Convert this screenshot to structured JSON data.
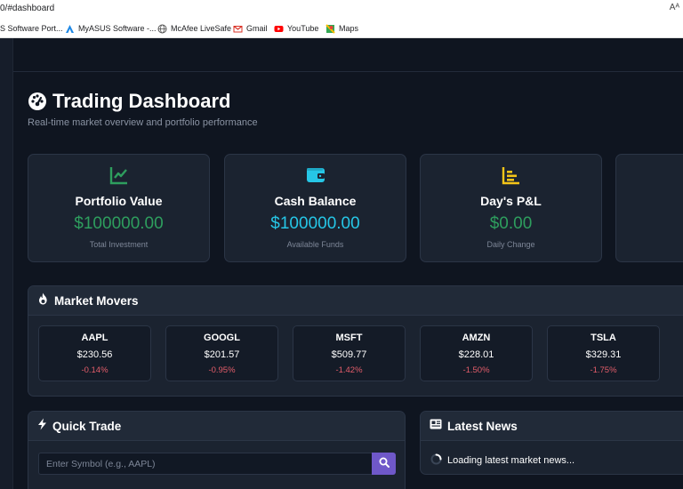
{
  "browser": {
    "url": "0/#dashboard",
    "reader_icon": "Aᴬ",
    "bookmarks": [
      {
        "label": "S Software Port...",
        "icon": "asus-icon"
      },
      {
        "label": "MyASUS Software -...",
        "icon": "myasus-icon"
      },
      {
        "label": "McAfee LiveSafe",
        "icon": "globe-icon"
      },
      {
        "label": "Gmail",
        "icon": "gmail-icon"
      },
      {
        "label": "YouTube",
        "icon": "youtube-icon"
      },
      {
        "label": "Maps",
        "icon": "maps-icon"
      }
    ]
  },
  "header": {
    "title": "Trading Dashboard",
    "subtitle": "Real-time market overview and portfolio performance",
    "icon": "speedometer-icon"
  },
  "stats": [
    {
      "label": "Portfolio Value",
      "value": "$100000.00",
      "note": "Total Investment",
      "icon": "chart-line-icon",
      "color": "#2e9e5e"
    },
    {
      "label": "Cash Balance",
      "value": "$100000.00",
      "note": "Available Funds",
      "icon": "wallet-icon",
      "color": "#26c6e6"
    },
    {
      "label": "Day's P&L",
      "value": "$0.00",
      "note": "Daily Change",
      "icon": "bar-chart-icon",
      "color": "#f5c518"
    }
  ],
  "market_movers": {
    "title": "Market Movers",
    "icon": "fire-icon",
    "items": [
      {
        "symbol": "AAPL",
        "price": "$230.56",
        "change": "-0.14%"
      },
      {
        "symbol": "GOOGL",
        "price": "$201.57",
        "change": "-0.95%"
      },
      {
        "symbol": "MSFT",
        "price": "$509.77",
        "change": "-1.42%"
      },
      {
        "symbol": "AMZN",
        "price": "$228.01",
        "change": "-1.50%"
      },
      {
        "symbol": "TSLA",
        "price": "$329.31",
        "change": "-1.75%"
      }
    ]
  },
  "quick_trade": {
    "title": "Quick Trade",
    "icon": "bolt-icon",
    "input_placeholder": "Enter Symbol (e.g., AAPL)",
    "input_value": ""
  },
  "news": {
    "title": "Latest News",
    "icon": "newspaper-icon",
    "loading_text": "Loading latest market news..."
  },
  "colors": {
    "negative": "#e35d6a",
    "accent": "#6f58c9",
    "background": "#0f1520"
  }
}
